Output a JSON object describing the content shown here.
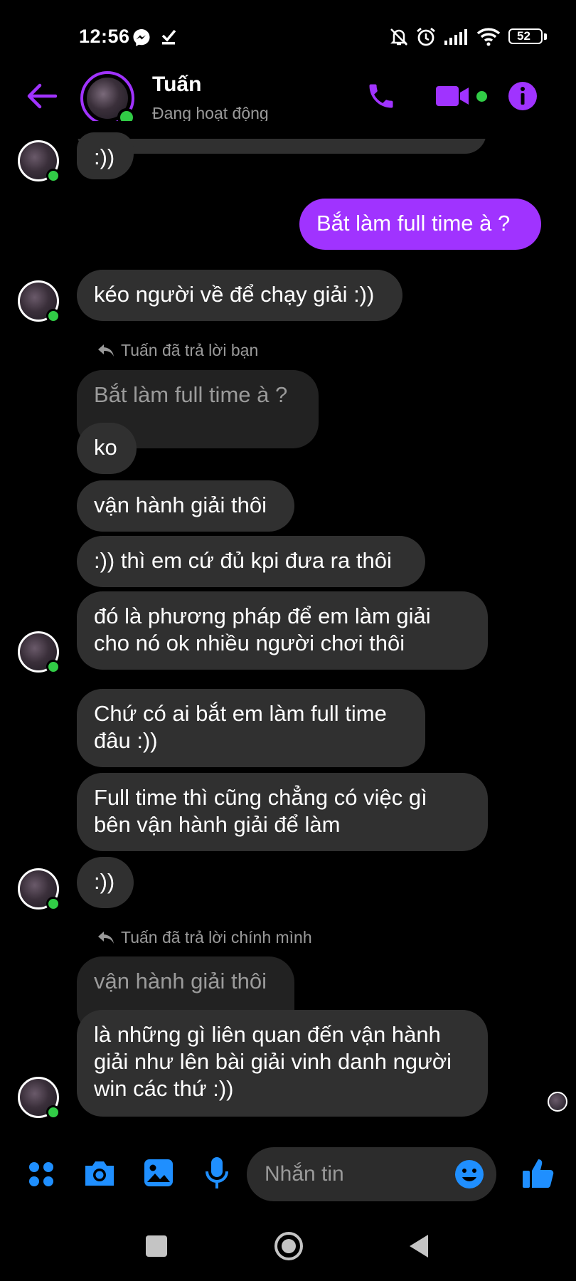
{
  "status_bar": {
    "time": "12:56",
    "battery": "52"
  },
  "header": {
    "name": "Tuấn",
    "presence": "Đang hoạt động"
  },
  "colors": {
    "accent": "#a033ff",
    "composer_icon": "#1f8fff",
    "online": "#31cc46",
    "bubble": "#303030"
  },
  "messages": {
    "m0": ":))",
    "m1": "Bắt làm full time à ?",
    "m2": "kéo người về để chạy giải :))",
    "reply1": "Tuấn đã trả lời bạn",
    "q1": "Bắt làm full time à ?",
    "m3": "ko",
    "m4": "vận hành giải thôi",
    "m5": ":)) thì em cứ đủ kpi đưa ra thôi",
    "m6": "đó là phương pháp để em làm giải\ncho nó ok nhiều người chơi thôi",
    "m7": "Chứ có ai bắt em làm full time\nđâu :))",
    "m8": "Full time thì cũng chẳng có việc gì\nbên vận hành giải để làm",
    "m9": ":))",
    "reply2": "Tuấn đã trả lời chính mình",
    "q2": "vận hành giải thôi",
    "m10": "là những gì liên quan đến vận hành\ngiải như lên bài giải vinh danh người\nwin các thứ :))"
  },
  "composer": {
    "placeholder": "Nhắn tin"
  },
  "icons": [
    "messenger-icon",
    "download-icon",
    "mute-icon",
    "alarm-icon",
    "signal-icon",
    "wifi-icon",
    "battery-icon",
    "back-arrow-icon",
    "phone-icon",
    "video-icon",
    "info-icon",
    "menu-grid-icon",
    "camera-icon",
    "image-icon",
    "mic-icon",
    "emoji-icon",
    "like-icon",
    "square-nav-icon",
    "home-nav-icon",
    "back-nav-icon",
    "reply-icon"
  ]
}
